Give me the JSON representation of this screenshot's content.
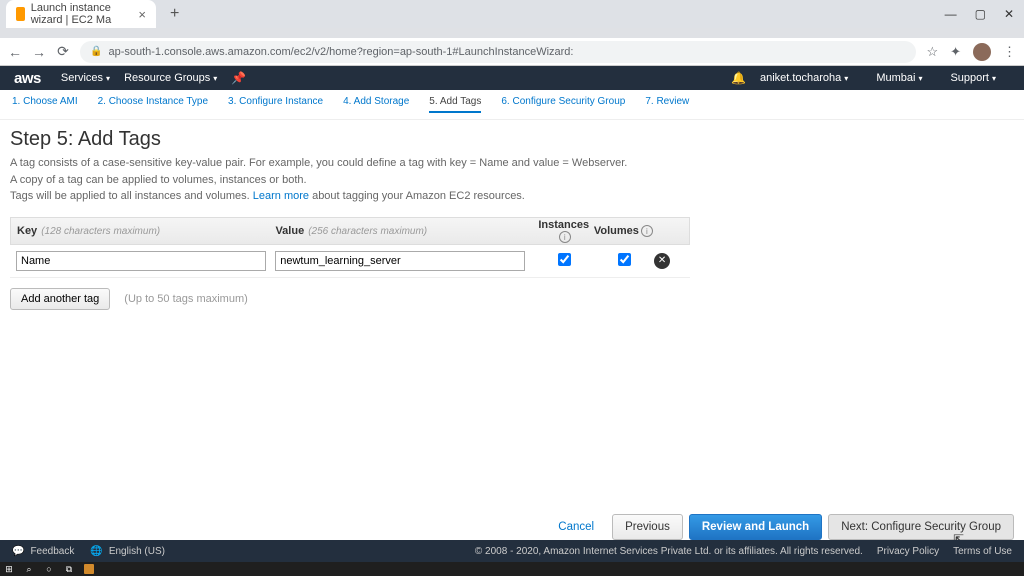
{
  "browser": {
    "tab_title": "Launch instance wizard | EC2 Ma",
    "url": "ap-south-1.console.aws.amazon.com/ec2/v2/home?region=ap-south-1#LaunchInstanceWizard:"
  },
  "header": {
    "services": "Services",
    "resource_groups": "Resource Groups",
    "account": "aniket.tocharoha",
    "region": "Mumbai",
    "support": "Support"
  },
  "steps": [
    "1. Choose AMI",
    "2. Choose Instance Type",
    "3. Configure Instance",
    "4. Add Storage",
    "5. Add Tags",
    "6. Configure Security Group",
    "7. Review"
  ],
  "page": {
    "title": "Step 5: Add Tags",
    "desc1": "A tag consists of a case-sensitive key-value pair. For example, you could define a tag with key = Name and value = Webserver.",
    "desc2": "A copy of a tag can be applied to volumes, instances or both.",
    "desc3a": "Tags will be applied to all instances and volumes. ",
    "learn_more": "Learn more",
    "desc3b": " about tagging your Amazon EC2 resources."
  },
  "table": {
    "key_label": "Key",
    "key_hint": "(128 characters maximum)",
    "value_label": "Value",
    "value_hint": "(256 characters maximum)",
    "instances_label": "Instances",
    "volumes_label": "Volumes",
    "row": {
      "key": "Name",
      "value": "newtum_learning_server",
      "instances_checked": true,
      "volumes_checked": true
    },
    "add_label": "Add another tag",
    "add_hint": "(Up to 50 tags maximum)"
  },
  "actions": {
    "cancel": "Cancel",
    "previous": "Previous",
    "review": "Review and Launch",
    "next": "Next: Configure Security Group"
  },
  "footer": {
    "feedback": "Feedback",
    "lang": "English (US)",
    "copyright": "© 2008 - 2020, Amazon Internet Services Private Ltd. or its affiliates. All rights reserved.",
    "privacy": "Privacy Policy",
    "terms": "Terms of Use"
  }
}
